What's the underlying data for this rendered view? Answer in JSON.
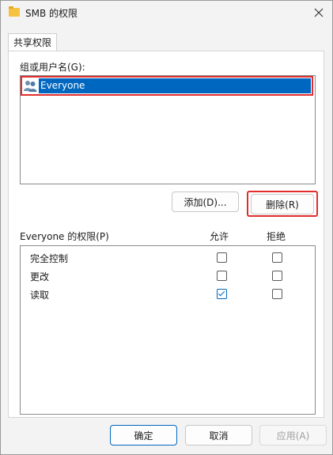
{
  "window": {
    "title": "SMB 的权限"
  },
  "tabs": [
    {
      "label": "共享权限"
    }
  ],
  "users": {
    "label": "组或用户名(G):",
    "items": [
      {
        "name": "Everyone",
        "icon": "user-group-icon"
      }
    ]
  },
  "buttons": {
    "add": "添加(D)...",
    "remove": "删除(R)"
  },
  "permissions": {
    "title": "Everyone 的权限(P)",
    "allow_header": "允许",
    "deny_header": "拒绝",
    "rows": [
      {
        "name": "完全控制",
        "allow": false,
        "deny": false
      },
      {
        "name": "更改",
        "allow": false,
        "deny": false
      },
      {
        "name": "读取",
        "allow": true,
        "deny": false
      }
    ]
  },
  "footer": {
    "ok": "确定",
    "cancel": "取消",
    "apply": "应用(A)"
  },
  "colors": {
    "accent": "#0067c0",
    "highlight_annotation": "#e12d2d"
  }
}
